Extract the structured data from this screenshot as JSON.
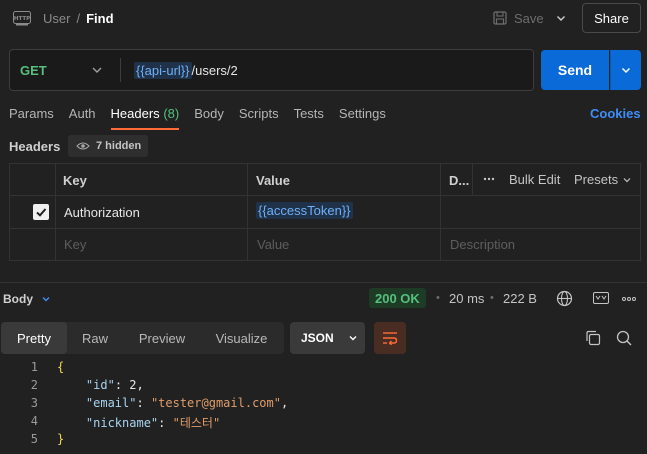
{
  "header": {
    "breadcrumb_parent": "User",
    "separator": "/",
    "current": "Find",
    "save_label": "Save",
    "share_label": "Share"
  },
  "request": {
    "method": "GET",
    "url_variable": "{{api-url}}",
    "url_path": "/users/2",
    "send_label": "Send"
  },
  "tabs": [
    {
      "label": "Params"
    },
    {
      "label": "Auth"
    },
    {
      "label": "Headers",
      "count": "(8)"
    },
    {
      "label": "Body"
    },
    {
      "label": "Scripts"
    },
    {
      "label": "Tests"
    },
    {
      "label": "Settings"
    }
  ],
  "cookies_label": "Cookies",
  "headers_section": {
    "title": "Headers",
    "hidden_label": "7 hidden",
    "columns": {
      "key": "Key",
      "value": "Value",
      "description": "D..."
    },
    "bulk_edit": "Bulk Edit",
    "presets": "Presets",
    "rows": [
      {
        "key": "Authorization",
        "value": "{{accessToken}}",
        "checked": true
      }
    ],
    "placeholders": {
      "key": "Key",
      "value": "Value",
      "description": "Description"
    }
  },
  "response": {
    "label": "Body",
    "status": "200 OK",
    "time": "20 ms",
    "size": "222 B",
    "view_tabs": [
      "Pretty",
      "Raw",
      "Preview",
      "Visualize"
    ],
    "active_view": "Pretty",
    "format": "JSON",
    "line_numbers": [
      "1",
      "2",
      "3",
      "4",
      "5"
    ],
    "json": {
      "open": "{",
      "close": "}",
      "id_key": "\"id\"",
      "id_val": "2",
      "email_key": "\"email\"",
      "email_val": "\"tester@gmail.com\"",
      "nickname_key": "\"nickname\"",
      "nickname_val": "\"테스터\""
    }
  },
  "colors": {
    "background": "#212121",
    "accent_send": "#0a6ad8",
    "method_get": "#55c07d",
    "tab_underline": "#ff6c37",
    "status_ok": "#55c07d",
    "link": "#3e8ef7"
  }
}
